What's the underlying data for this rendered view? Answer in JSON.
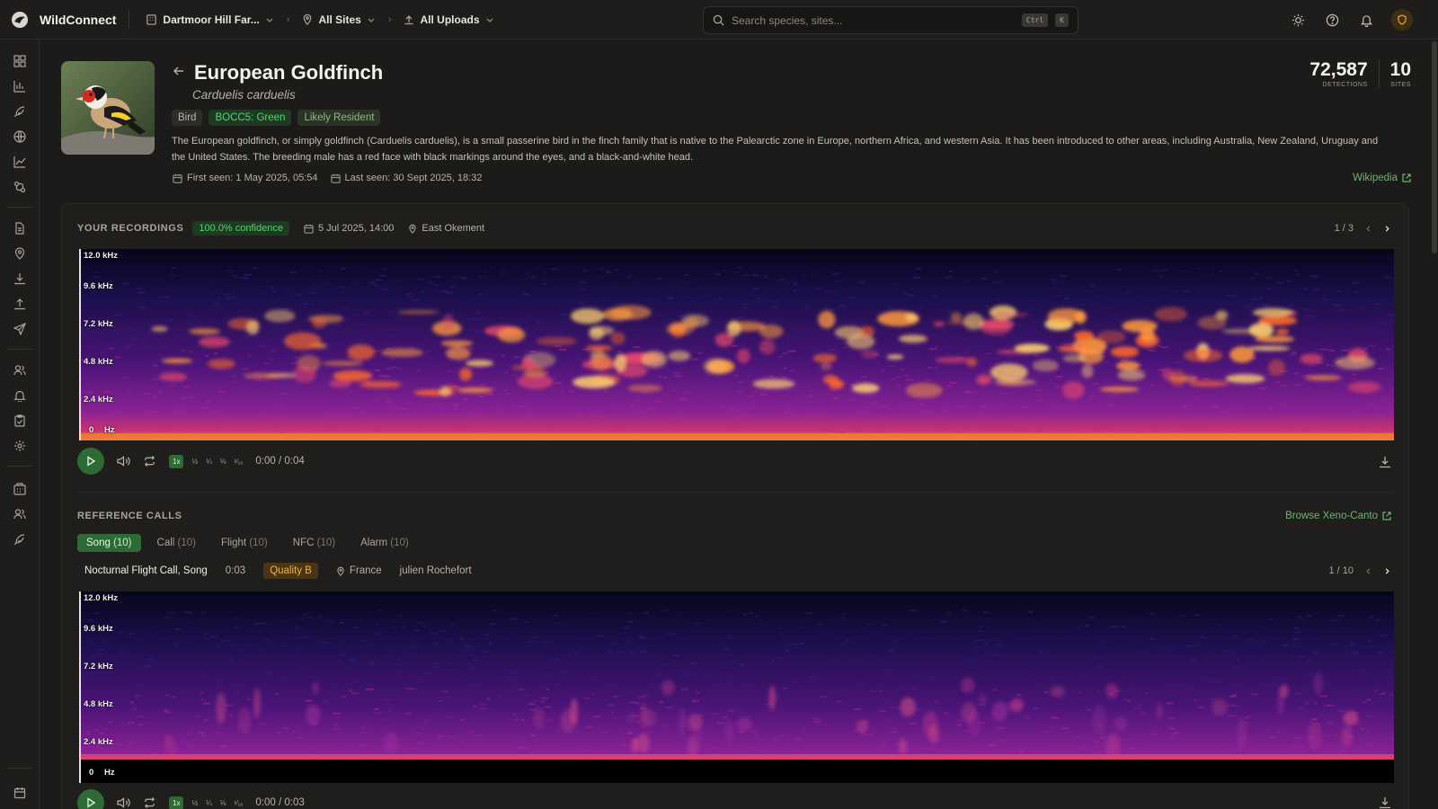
{
  "app": {
    "name": "WildConnect",
    "breadcrumb": [
      "Dartmoor Hill Far...",
      "All Sites",
      "All Uploads"
    ],
    "search_placeholder": "Search species, sites...",
    "shortcut": [
      "Ctrl",
      "K"
    ]
  },
  "species": {
    "common_name": "European Goldfinch",
    "scientific_name": "Carduelis carduelis",
    "tags": [
      "Bird",
      "BOCC5: Green",
      "Likely Resident"
    ],
    "description": "The European goldfinch, or simply goldfinch (Carduelis carduelis), is a small passerine bird in the finch family that is native to the Palearctic zone in Europe, northern Africa, and western Asia. It has been introduced to other areas, including Australia, New Zealand, Uruguay and the United States. The breeding male has a red face with black markings around the eyes, and a black-and-white head.",
    "first_seen": "First seen: 1 May 2025, 05:54",
    "last_seen": "Last seen: 30 Sept 2025, 18:32",
    "wiki_label": "Wikipedia",
    "stats": [
      {
        "value": "72,587",
        "label": "DETECTIONS"
      },
      {
        "value": "10",
        "label": "SITES"
      }
    ]
  },
  "recordings": {
    "title": "YOUR RECORDINGS",
    "confidence": "100.0% confidence",
    "date": "5 Jul 2025, 14:00",
    "site": "East Okement",
    "pager": "1 / 3",
    "time": "0:00 / 0:04",
    "freq_labels": [
      "12.0 kHz",
      "9.6 kHz",
      "7.2 kHz",
      "4.8 kHz",
      "2.4 kHz",
      "0"
    ],
    "hz": "Hz"
  },
  "playback": {
    "speeds": [
      "1x",
      "½",
      "¼",
      "⅛",
      "¹⁄₁₆"
    ]
  },
  "reference": {
    "title": "REFERENCE CALLS",
    "browse_label": "Browse Xeno-Canto",
    "tabs": [
      {
        "label": "Song",
        "count": "(10)",
        "active": true
      },
      {
        "label": "Call",
        "count": "(10)",
        "active": false
      },
      {
        "label": "Flight",
        "count": "(10)",
        "active": false
      },
      {
        "label": "NFC",
        "count": "(10)",
        "active": false
      },
      {
        "label": "Alarm",
        "count": "(10)",
        "active": false
      }
    ],
    "call_type": "Nocturnal Flight Call, Song",
    "duration": "0:03",
    "quality": "Quality B",
    "country": "France",
    "recordist": "julien Rochefort",
    "pager": "1 / 10",
    "time": "0:00 / 0:03",
    "freq_labels": [
      "12.0 kHz",
      "9.6 kHz",
      "7.2 kHz",
      "4.8 kHz",
      "2.4 kHz",
      "0"
    ],
    "hz": "Hz"
  },
  "colors": {
    "accent_green": "#2e6a36",
    "text_green": "#4fd66a",
    "quality_amber": "#f0b23c"
  }
}
